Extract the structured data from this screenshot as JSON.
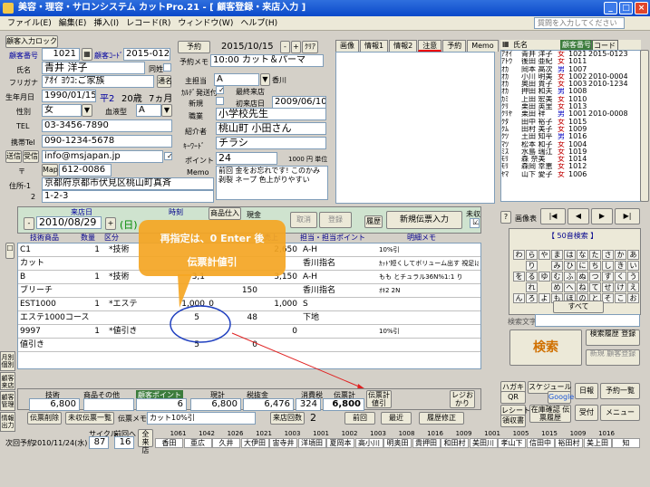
{
  "window": {
    "title": "美容・理容・サロンシステム カットPro.21 - [ 顧客登録・来店入力 ]",
    "min": "_",
    "max": "□",
    "close": "×"
  },
  "menu": [
    "ファイル(E)",
    "編集(E)",
    "挿入(I)",
    "レコード(R)",
    "ウィンドウ(W)",
    "ヘルプ(H)"
  ],
  "menu_search_placeholder": "質問を入力してください",
  "customer": {
    "section_button": "顧客入力ロック",
    "no_label": "顧客番号",
    "no": "1021",
    "code_label": "顧客ｺｰﾄﾞ",
    "code": "2015-0123",
    "name_label": "氏名",
    "name": "青井 洋子",
    "nick_label": "同姓",
    "kana_label": "フリガナ",
    "kana": "ｱｵｲ ﾖｳｺ:ご家族",
    "kana_btn": "通名",
    "birth_label": "生年月日",
    "birth": "1990/01/15",
    "era": "平2",
    "age": "20歳",
    "month": "7ヵ月",
    "sex_label": "性別",
    "sex": "女",
    "blood_label": "血液型",
    "blood": "A",
    "tel_label": "TEL",
    "tel": "03-3456-7890",
    "mobile_label": "携帯Tel",
    "mobile": "090-1234-5678",
    "mail_btn1": "送信",
    "mail_btn2": "受信",
    "mail": "info@msjapan.jp",
    "zip_label": "〒",
    "map_btn": "Map",
    "zip": "612-0086",
    "addr_label": "住所-1",
    "addr1": "京都府京都市伏見区桃山町真斉",
    "addr2_label": "2",
    "addr2": "1-2-3"
  },
  "visit": {
    "date_label": "予約",
    "date": "2015/10/15",
    "minus": "-",
    "plus": "+",
    "clear": "ｸﾘｱ",
    "memo_label": "予約メモ",
    "memo": "10:00 カット＆パーマ",
    "staff_label": "主担当",
    "staff": "A",
    "staff_name": "香川",
    "kaiin_label": "ｶﾙﾃﾞ発送付",
    "kaiin": "最終来店",
    "kaiin_date": "",
    "new_label": "新規",
    "first_label": "初来店日",
    "first": "2009/06/10",
    "job_label": "職業",
    "job": "小学校先生",
    "intro_label": "紹介者",
    "intro": "桃山町 小田さん",
    "kw_label": "ｷｰﾜｰﾄﾞ",
    "kw": "チラシ",
    "point_label": "ポイント",
    "point": "24",
    "point_unit": "1000 円 単位",
    "note_label": "Memo",
    "note": "前回 金をお忘れです! このかみ 剥裂 ネープ 色上がりやすい"
  },
  "right_tabs": [
    "画像",
    "情報1",
    "情報2",
    "注意",
    "予約",
    "Memo"
  ],
  "list": {
    "header": [
      "氏名",
      "",
      "顧客番号",
      "コード"
    ],
    "rows": [
      [
        "ｱｵｲ",
        "青井 洋子",
        "女",
        "1021",
        "2015-0123"
      ],
      [
        "ｱﾄｳ",
        "後田 亜紀",
        "女",
        "1011",
        ""
      ],
      [
        "ｵｶ",
        "岡本 高次",
        "男",
        "1007",
        ""
      ],
      [
        "ｵｶ",
        "小川 明美",
        "女",
        "1002",
        "2010-0004"
      ],
      [
        "ｵｶ",
        "奥田 貴子",
        "女",
        "1003",
        "2010-1234"
      ],
      [
        "ｵｶ",
        "押田 和夫",
        "男",
        "1008",
        ""
      ],
      [
        "ｶﾐ",
        "上田 宏美",
        "女",
        "1010",
        ""
      ],
      [
        "ｸﾘ",
        "栗田 英里",
        "女",
        "1013",
        ""
      ],
      [
        "ｸﾘﾔ",
        "栗田 祥",
        "男",
        "1001",
        "2010-0008"
      ],
      [
        "ｸﾀ",
        "田中 裕子",
        "女",
        "1015",
        ""
      ],
      [
        "ｸﾑ",
        "田村 美子",
        "女",
        "1009",
        ""
      ],
      [
        "ｸﾂ",
        "土田 知平",
        "男",
        "1016",
        ""
      ],
      [
        "ﾏﾂ",
        "松本 和子",
        "女",
        "1004",
        ""
      ],
      [
        "ﾐｽ",
        "水島 瑞江",
        "女",
        "1019",
        ""
      ],
      [
        "ﾓﾘ",
        "森 奈美",
        "女",
        "1014",
        ""
      ],
      [
        "ﾓﾘ",
        "森岡 幸恵",
        "女",
        "1012",
        ""
      ],
      [
        "ﾔﾏ",
        "山下 愛子",
        "女",
        "1006",
        ""
      ]
    ]
  },
  "slip": {
    "date_label": "来店日",
    "date": "2010/08/29",
    "weekday": "(日)",
    "time_label": "時刻",
    "product_label": "商品仕入",
    "cash": "現金",
    "cancel": "取消",
    "register": "登録",
    "history": "履歴",
    "new_slip": "新規伝票入力",
    "done": "未収"
  },
  "grid_headers": [
    "技術商品",
    "数量",
    "区分",
    "",
    "",
    "",
    "",
    "売上",
    "担当・担当ポイント",
    "明細メモ"
  ],
  "grid_rows": [
    {
      "code": "C1",
      "qty": "1",
      "kind": "*技術",
      "price": "",
      "disc": "",
      "amount": "2,650",
      "pt": "A-H",
      "memo": "10%引",
      "memo2": "ｶｯﾄ'短くしてボリューム出す 視足は首につく位",
      "name": "カット",
      "staff": "香川指名"
    },
    {
      "code": "B",
      "qty": "1",
      "kind": "*技術",
      "price": "3,1",
      "disc": "",
      "amount": "3,150",
      "pt": "A-H",
      "memo": "もも とチュラル36N%1:1 り",
      "memo2": "ｵｷ2 2N",
      "name": "ブリーチ",
      "staff": "香川指名",
      "sub": "150"
    },
    {
      "code": "EST1000",
      "qty": "1",
      "kind": "*エステ",
      "price": "1,000",
      "disc": "0",
      "amount": "1,000",
      "pt": "S",
      "memo": "",
      "name": "エステ1000コース",
      "staff": "下地",
      "sub": "48",
      "subdisc": "5"
    },
    {
      "code": "9997",
      "qty": "1",
      "kind": "*値引き",
      "price": "",
      "disc": "",
      "amount": "0",
      "pt": "",
      "memo": "10%引",
      "name": "値引き",
      "sub": "0",
      "subdisc": "5"
    }
  ],
  "callout": {
    "line1": "再指定は、0 Enter 後",
    "line2": "伝票計値引"
  },
  "totals": {
    "tech_label": "技術",
    "tech": "6,800",
    "prod_label": "商品その他",
    "prod": "",
    "pt_label": "顧客ポイント",
    "pt": "6",
    "sub_label": "現計",
    "sub": "6,800",
    "taxed_label": "税抜金",
    "taxed": "6,476",
    "tax_label": "消費税",
    "tax": "324",
    "total_label": "伝票計",
    "total": "6,800",
    "btn_slip": "伝票計値引",
    "btn_receipt": "レジおかり"
  },
  "footer": {
    "slip_del": "伝票削除",
    "prev_list": "未収伝票一覧",
    "memo_label": "伝票メモ",
    "memo": "カット10%引",
    "count_btn": "来店回数",
    "count": "2",
    "prev": "前回",
    "latest": "最近",
    "fix": "履歴修正"
  },
  "next": {
    "label": "次回予約",
    "date": "2010/11/24(水)",
    "cycle_label": "サイクル",
    "cycle": "87",
    "days_label": "前回へ",
    "days": "16"
  },
  "visit_history": {
    "label": "全来店",
    "names": [
      "香田",
      "亜広",
      "久井",
      "大伊田",
      "宙寺井",
      "洋頃田",
      "夏岡本",
      "高小川",
      "明奥田",
      "貴押田",
      "和田村",
      "美田川",
      "孝山下",
      "信田中",
      "裕田村",
      "美上田",
      "知"
    ],
    "nums": [
      "1061",
      "1042",
      "1026",
      "1021",
      "1003",
      "1001",
      "1002",
      "1003",
      "1008",
      "1016",
      "1009",
      "1001",
      "1005",
      "1015",
      "1009",
      "1016"
    ]
  },
  "side_buttons": {
    "img": "画像表",
    "first": "|◀",
    "prev": "◀",
    "next": "▶",
    "last": "▶|",
    "kana_title": "【 50音検索 】",
    "search_label": "検索文字",
    "search": "検索",
    "history": "検索履歴 登録",
    "favorite": "新規 顧客登録",
    "b1": "ハガキ",
    "b2": "スケジュール",
    "b3": "日報",
    "b4": "予約一覧",
    "b5": "QR",
    "b6": "Google",
    "b7": "レシート",
    "b8": "在庫確認 伝票履歴",
    "b9": "受付",
    "b10": "メニュー",
    "b11": "領収書"
  },
  "kana": [
    "わ",
    "ら",
    "や",
    "ま",
    "は",
    "な",
    "た",
    "さ",
    "か",
    "あ",
    "",
    "り",
    "",
    "み",
    "ひ",
    "に",
    "ち",
    "し",
    "き",
    "い",
    "を",
    "る",
    "ゆ",
    "む",
    "ふ",
    "ぬ",
    "つ",
    "す",
    "く",
    "う",
    "",
    "れ",
    "",
    "め",
    "へ",
    "ね",
    "て",
    "せ",
    "け",
    "え",
    "ん",
    "ろ",
    "よ",
    "も",
    "ほ",
    "の",
    "と",
    "そ",
    "こ",
    "お"
  ],
  "kana_all": "すべて",
  "vtabs": [
    "月別 個別",
    "顧客 来店",
    "顧客 管理",
    "情報 出力"
  ]
}
